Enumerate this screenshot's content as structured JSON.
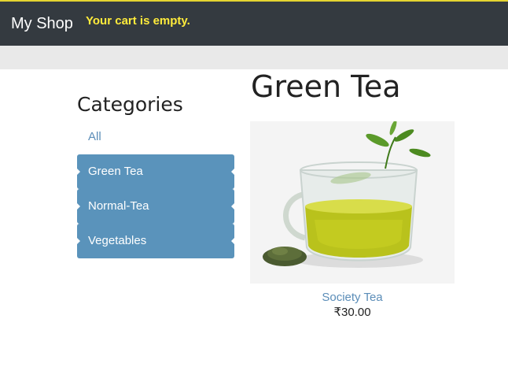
{
  "header": {
    "brand": "My Shop",
    "cart_status": "Your cart is empty."
  },
  "sidebar": {
    "title": "Categories",
    "all_label": "All",
    "items": [
      {
        "label": "Green Tea"
      },
      {
        "label": "Normal-Tea"
      },
      {
        "label": "Vegetables"
      }
    ]
  },
  "main": {
    "title": "Green Tea",
    "products": [
      {
        "name": "Society Tea",
        "price": "₹30.00",
        "image": "green-tea-cup"
      }
    ]
  },
  "colors": {
    "header_bg": "#343a40",
    "header_accent": "#e4d431",
    "cart_text": "#ffeb3b",
    "category_bg": "#5a93bb",
    "link": "#5b8db8"
  }
}
